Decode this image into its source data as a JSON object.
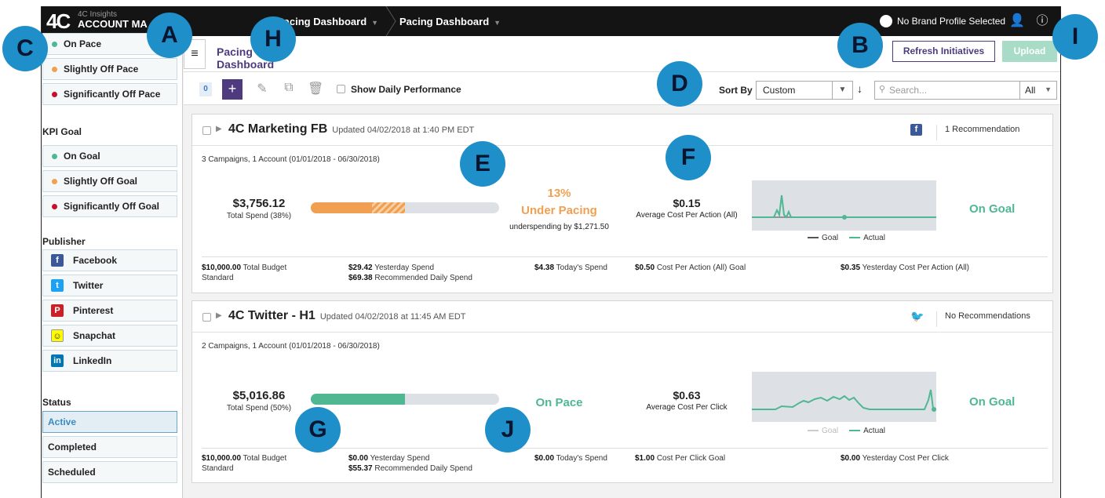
{
  "topbar": {
    "logo": "4C",
    "app_small": "4C Insights",
    "app_large": "ACCOUNT MA",
    "crumb1": "Pacing Dashboard",
    "crumb2": "Pacing Dashboard",
    "brand": "No Brand Profile Selected"
  },
  "sidebar": {
    "pacing_items": [
      {
        "label": "On Pace",
        "color": "#4fb792"
      },
      {
        "label": "Slightly Off Pace",
        "color": "#f0a050"
      },
      {
        "label": "Significantly Off Pace",
        "color": "#c8102e"
      }
    ],
    "kpi_heading": "KPI Goal",
    "kpi_items": [
      {
        "label": "On Goal",
        "color": "#4fb792"
      },
      {
        "label": "Slightly Off Goal",
        "color": "#f0a050"
      },
      {
        "label": "Significantly Off Goal",
        "color": "#c8102e"
      }
    ],
    "publisher_heading": "Publisher",
    "publishers": [
      {
        "label": "Facebook",
        "icon": "facebook-icon",
        "color": "#3b5998",
        "glyph": "f"
      },
      {
        "label": "Twitter",
        "icon": "twitter-icon",
        "color": "#1da1f2",
        "glyph": "t"
      },
      {
        "label": "Pinterest",
        "icon": "pinterest-icon",
        "color": "#cb2027",
        "glyph": "P"
      },
      {
        "label": "Snapchat",
        "icon": "snapchat-icon",
        "color": "#fffc00",
        "glyph": "☺"
      },
      {
        "label": "LinkedIn",
        "icon": "linkedin-icon",
        "color": "#0077b5",
        "glyph": "in"
      }
    ],
    "status_heading": "Status",
    "status_items": [
      "Active",
      "Completed",
      "Scheduled"
    ]
  },
  "subhead": {
    "tab": "Pacing Dashboard",
    "refresh": "Refresh Initiatives",
    "upload": "Upload"
  },
  "toolbar": {
    "count": "0",
    "add": "+",
    "show_daily": "Show Daily Performance",
    "sort_label": "Sort By",
    "sort_value": "Custom",
    "search_placeholder": "Search...",
    "filter": "All"
  },
  "cards": [
    {
      "title": "4C Marketing FB",
      "updated": "Updated 04/02/2018 at 1:40 PM EDT",
      "publisher_icon": "facebook-icon",
      "recommendation": "1 Recommendation",
      "summary": "3 Campaigns, 1 Account (01/01/2018 - 06/30/2018)",
      "spend": "$3,756.12",
      "spend_label": "Total Spend (38%)",
      "progress": 0.38,
      "projected": 0.5,
      "pacing_pct": "13%",
      "pacing_status": "Under Pacing",
      "pacing_color": "#f0a050",
      "pacing_note": "underspending by $1,271.50",
      "kpi_value": "$0.15",
      "kpi_label": "Average Cost Per Action (All)",
      "legend_goal": "Goal",
      "legend_actual": "Actual",
      "goal_status": "On Goal",
      "budget": "$10,000.00",
      "budget_label": "Total Budget",
      "budget_type": "Standard",
      "yesterday_spend": "$29.42",
      "yesterday_label": "Yesterday Spend",
      "recommended": "$69.38",
      "recommended_label": "Recommended Daily Spend",
      "today_spend": "$4.38",
      "today_label": "Today's Spend",
      "kpi_goal": "$0.50",
      "kpi_goal_label": "Cost Per Action (All) Goal",
      "kpi_yesterday": "$0.35",
      "kpi_yesterday_label": "Yesterday Cost Per Action (All)"
    },
    {
      "title": "4C Twitter - H1",
      "updated": "Updated 04/02/2018 at 11:45 AM EDT",
      "publisher_icon": "twitter-icon",
      "recommendation": "No Recommendations",
      "summary": "2 Campaigns, 1 Account (01/01/2018 - 06/30/2018)",
      "spend": "$5,016.86",
      "spend_label": "Total Spend (50%)",
      "progress": 0.5,
      "pacing_status": "On Pace",
      "pacing_color": "#4fb792",
      "kpi_value": "$0.63",
      "kpi_label": "Average Cost Per Click",
      "legend_goal": "Goal",
      "legend_actual": "Actual",
      "goal_status": "On Goal",
      "budget": "$10,000.00",
      "budget_label": "Total Budget",
      "budget_type": "Standard",
      "yesterday_spend": "$0.00",
      "yesterday_label": "Yesterday Spend",
      "recommended": "$55.37",
      "recommended_label": "Recommended Daily Spend",
      "today_spend": "$0.00",
      "today_label": "Today's Spend",
      "kpi_goal": "$1.00",
      "kpi_goal_label": "Cost Per Click Goal",
      "kpi_yesterday": "$0.00",
      "kpi_yesterday_label": "Yesterday Cost Per Click"
    }
  ],
  "callouts": [
    "A",
    "B",
    "C",
    "D",
    "E",
    "F",
    "G",
    "H",
    "I",
    "J"
  ]
}
